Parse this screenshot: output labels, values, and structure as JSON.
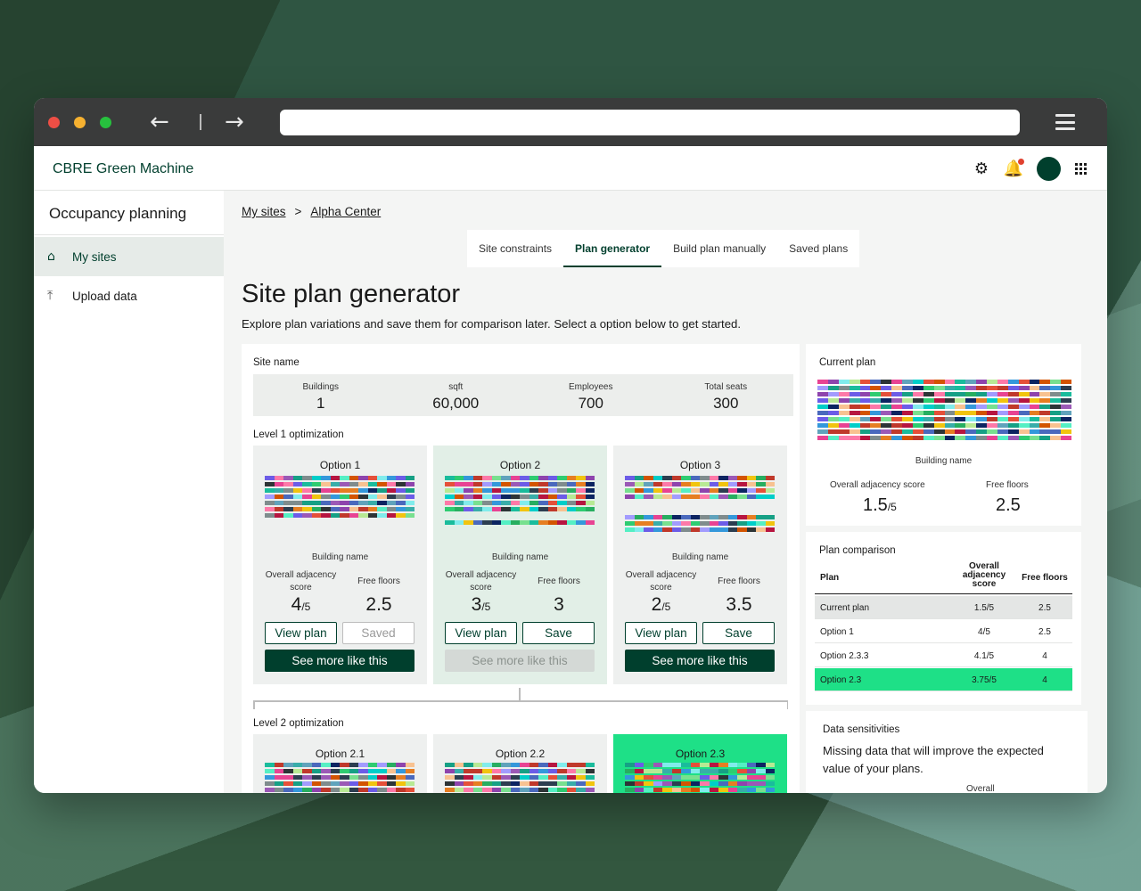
{
  "browser": {
    "back_icon": "arrow-left-icon",
    "forward_icon": "arrow-right-icon",
    "menu_icon": "hamburger-icon"
  },
  "app": {
    "brand": "CBRE Green Machine",
    "icons": [
      "gear-icon",
      "bell-icon",
      "avatar",
      "apps-grid-icon"
    ],
    "accent_color": "#003f2d",
    "highlight_color": "#1ee087"
  },
  "sidebar": {
    "title": "Occupancy planning",
    "items": [
      {
        "label": "My sites",
        "icon": "home-icon",
        "active": true
      },
      {
        "label": "Upload data",
        "icon": "upload-icon",
        "active": false
      }
    ]
  },
  "breadcrumb": {
    "root": "My sites",
    "separator": ">",
    "current": "Alpha Center"
  },
  "tabs": [
    {
      "label": "Site constraints",
      "active": false
    },
    {
      "label": "Plan generator",
      "active": true
    },
    {
      "label": "Build plan manually",
      "active": false
    },
    {
      "label": "Saved plans",
      "active": false
    }
  ],
  "page": {
    "title": "Site plan generator",
    "subtitle": "Explore plan variations and save them for comparison later. Select a option below to get started."
  },
  "site": {
    "label": "Site name",
    "stats": [
      {
        "label": "Buildings",
        "value": "1"
      },
      {
        "label": "sqft",
        "value": "60,000"
      },
      {
        "label": "Employees",
        "value": "700"
      },
      {
        "label": "Total seats",
        "value": "300"
      }
    ]
  },
  "level1": {
    "label": "Level 1 optimization",
    "options": [
      {
        "title": "Option 1",
        "building": "Building name",
        "score_label": "Overall adjacency score",
        "score": "4",
        "score_den": "/5",
        "floors_label": "Free floors",
        "floors": "2.5",
        "view_label": "View plan",
        "save_label": "Saved",
        "more_label": "See more like this"
      },
      {
        "title": "Option 2",
        "building": "Building name",
        "score_label": "Overall adjacency score",
        "score": "3",
        "score_den": "/5",
        "floors_label": "Free floors",
        "floors": "3",
        "view_label": "View plan",
        "save_label": "Save",
        "more_label": "See more like this"
      },
      {
        "title": "Option 3",
        "building": "Building name",
        "score_label": "Overall adjacency score",
        "score": "2",
        "score_den": "/5",
        "floors_label": "Free floors",
        "floors": "3.5",
        "view_label": "View plan",
        "save_label": "Save",
        "more_label": "See more like this"
      }
    ]
  },
  "level2": {
    "label": "Level 2 optimization",
    "options": [
      {
        "title": "Option 2.1"
      },
      {
        "title": "Option 2.2"
      },
      {
        "title": "Option 2.3"
      }
    ]
  },
  "current_plan": {
    "title": "Current plan",
    "building": "Building name",
    "score_label": "Overall adjacency score",
    "score": "1.5",
    "score_den": "/5",
    "floors_label": "Free floors",
    "floors": "2.5"
  },
  "comparison": {
    "title": "Plan comparison",
    "headers": [
      "Plan",
      "Overall adjacency score",
      "Free floors"
    ],
    "rows": [
      {
        "plan": "Current plan",
        "score": "1.5/5",
        "floors": "2.5"
      },
      {
        "plan": "Option 1",
        "score": "4/5",
        "floors": "2.5"
      },
      {
        "plan": "Option 2.3.3",
        "score": "4.1/5",
        "floors": "4"
      },
      {
        "plan": "Option 2.3",
        "score": "3.75/5",
        "floors": "4"
      }
    ]
  },
  "sensitivities": {
    "title": "Data sensitivities",
    "text": "Missing data that will improve the expected value of your plans.",
    "more": "Overall"
  },
  "palette": [
    "#c0392b",
    "#2ecc71",
    "#3498db",
    "#9b59b6",
    "#e84393",
    "#1abc9c",
    "#f1c40f",
    "#16a085",
    "#8e44ad",
    "#2c3e50",
    "#e67e22",
    "#27ae60",
    "#d35400",
    "#7f8c8d",
    "#6c5ce7",
    "#00cec9",
    "#fd79a8",
    "#55efc4",
    "#a29bfe",
    "#81ecec",
    "#2d3436",
    "#b8e994",
    "#4a69bd",
    "#e55039",
    "#78e08f",
    "#60a3bc",
    "#b71540",
    "#0c2461",
    "#f8c291",
    "#38ada9"
  ]
}
